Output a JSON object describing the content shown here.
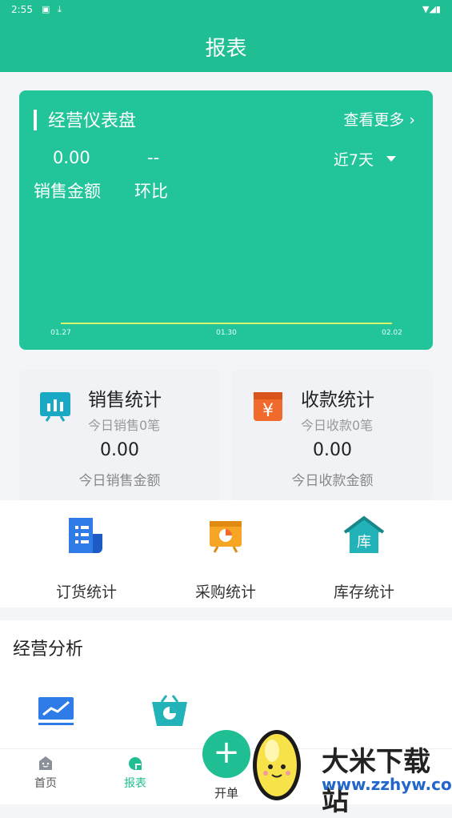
{
  "status": {
    "time": "2:55",
    "icons": [
      "notification-icon",
      "download-icon",
      "wifi-icon",
      "signal-icon",
      "battery-icon"
    ]
  },
  "header": {
    "title": "报表"
  },
  "dashboard": {
    "title": "经营仪表盘",
    "more": "查看更多 ›",
    "sales_value": "0.00",
    "compare_value": "--",
    "sales_label": "销售金额",
    "compare_label": "环比",
    "period": "近7天",
    "chart_data": {
      "type": "line",
      "x": [
        "01.27",
        "01.30",
        "02.02"
      ],
      "series": [
        {
          "values": [
            0,
            0,
            0
          ]
        }
      ],
      "grid": false,
      "line_color": "#d7f36a"
    }
  },
  "cards": {
    "sales": {
      "title": "销售统计",
      "sub": "今日销售0笔",
      "amount": "0.00",
      "amount_label": "今日销售金额",
      "icon": "sales-chart-icon"
    },
    "receipt": {
      "title": "收款统计",
      "sub": "今日收款0笔",
      "amount": "0.00",
      "amount_label": "今日收款金额",
      "icon": "yen-icon"
    }
  },
  "quick": [
    {
      "label": "订货统计",
      "icon": "order-list-icon"
    },
    {
      "label": "采购统计",
      "icon": "purchase-icon"
    },
    {
      "label": "库存统计",
      "icon": "warehouse-icon"
    }
  ],
  "analysis": {
    "title": "经营分析"
  },
  "tabs": {
    "home": "首页",
    "report": "报表",
    "create": "开单"
  },
  "watermark": {
    "name": "大米下载站",
    "url": "www.zzhyw.com"
  },
  "colors": {
    "brand": "#1fbf93",
    "dashboard": "#22c49a"
  }
}
